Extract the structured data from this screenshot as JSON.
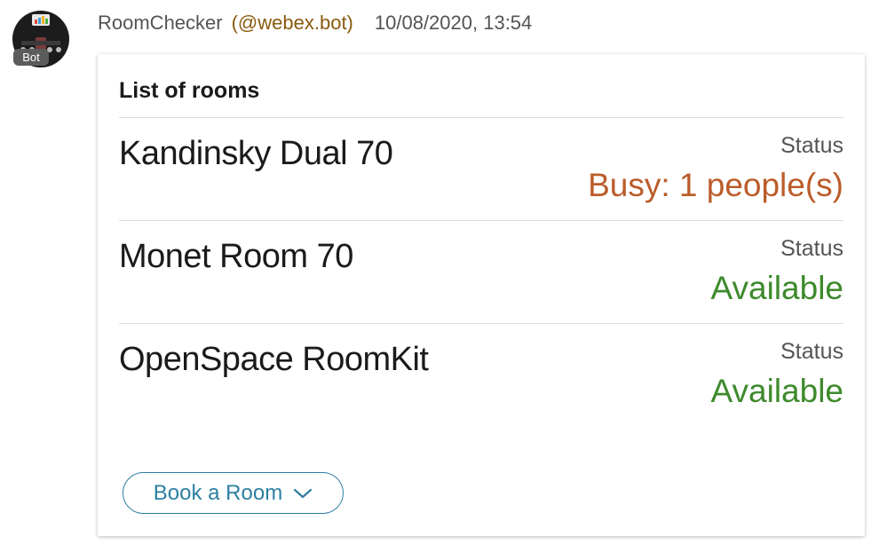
{
  "message": {
    "sender": "RoomChecker",
    "handle": "(@webex.bot)",
    "timestamp": "10/08/2020, 13:54",
    "badge": "Bot",
    "avatar_icon": "bot-avatar-icon"
  },
  "card": {
    "title": "List of rooms",
    "rooms": [
      {
        "name": "Kandinsky Dual 70",
        "status_label": "Status",
        "status": "Busy: 1 people(s)",
        "status_color": "#bb5c2a"
      },
      {
        "name": "Monet Room 70",
        "status_label": "Status",
        "status": "Available",
        "status_color": "#3e8a2c"
      },
      {
        "name": "OpenSpace RoomKit",
        "status_label": "Status",
        "status": "Available",
        "status_color": "#3e8a2c"
      }
    ],
    "action_button": {
      "label": "Book a Room",
      "icon": "chevron-down-icon",
      "color": "#2d7fa3"
    }
  }
}
